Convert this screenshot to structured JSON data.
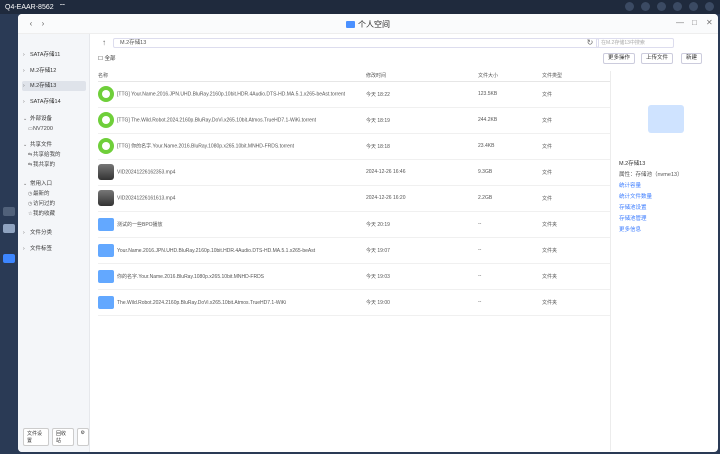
{
  "system": {
    "host": "Q4-EAAR-8562",
    "wifi_icon": "wifi-icon"
  },
  "window": {
    "title": "个人空间"
  },
  "sidebar": {
    "storages": [
      "SATA存储11",
      "M.2存储12",
      "M.2存储13",
      "SATA存储14"
    ],
    "external_header": "外部设备",
    "external_device": "NV7200",
    "shared_header": "共享文件",
    "shared_items": [
      "共享给我的",
      "我共享的"
    ],
    "quick_header": "常用入口",
    "quick_items": [
      "最新的",
      "访问过的",
      "我的收藏"
    ],
    "file_class": "文件分类",
    "file_tags": "文件标签",
    "bottom": [
      "文件设置",
      "回收站"
    ]
  },
  "toolbar": {
    "path": "M.2存储13",
    "search_placeholder": "在M.2存储13中搜索"
  },
  "actions": {
    "select_all": "全部",
    "more": "更多操作",
    "upload": "上传文件",
    "new": "新建"
  },
  "table": {
    "columns": [
      "名称",
      "修改时间",
      "文件大小",
      "文件类型"
    ],
    "rows": [
      {
        "icon": "torrent",
        "name": "[TTG] Your.Name.2016.JPN.UHD.BluRay.2160p.10bit.HDR.4Audio.DTS-HD.MA.5.1.x265-beAst.torrent",
        "time": "今天 18:22",
        "size": "123.5KB",
        "type": "文件"
      },
      {
        "icon": "torrent",
        "name": "[TTG] The.Wild.Robot.2024.2160p.BluRay.DoVi.x265.10bit.Atmos.TrueHD7.1-WiKi.torrent",
        "time": "今天 18:19",
        "size": "244.2KB",
        "type": "文件"
      },
      {
        "icon": "torrent",
        "name": "[TTG] 你的名字.Your.Name.2016.BluRay.1080p.x265.10bit.MNHD-FRDS.torrent",
        "time": "今天 18:18",
        "size": "23.4KB",
        "type": "文件"
      },
      {
        "icon": "video",
        "name": "VID20241226162353.mp4",
        "time": "2024-12-26 16:46",
        "size": "9.3GB",
        "type": "文件"
      },
      {
        "icon": "video",
        "name": "VID20241226161613.mp4",
        "time": "2024-12-26 16:20",
        "size": "2.2GB",
        "type": "文件"
      },
      {
        "icon": "folder",
        "name": "测试的一些BPO播放",
        "time": "今天 20:19",
        "size": "--",
        "type": "文件夹"
      },
      {
        "icon": "folder",
        "name": "Your.Name.2016.JPN.UHD.BluRay.2160p.10bit.HDR.4Audio.DTS-HD.MA.5.1.x265-beAst",
        "time": "今天 19:07",
        "size": "--",
        "type": "文件夹"
      },
      {
        "icon": "folder",
        "name": "你的名字.Your.Name.2016.BluRay.1080p.x265.10bit.MNHD-FRDS",
        "time": "今天 19:03",
        "size": "--",
        "type": "文件夹"
      },
      {
        "icon": "folder",
        "name": "The.Wild.Robot.2024.2160p.BluRay.DoVi.x265.10bit.Atmos.TrueHD7.1-WiKi",
        "time": "今天 19:00",
        "size": "--",
        "type": "文件夹"
      }
    ]
  },
  "panel": {
    "name": "M.2存储13",
    "property": "属性：存储池（nvme13）",
    "links": [
      "统计容量",
      "统计文件数量",
      "存储池设置",
      "存储池管理",
      "更多信息"
    ]
  }
}
